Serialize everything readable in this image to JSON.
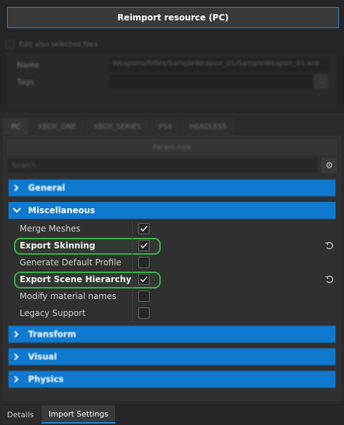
{
  "header": {
    "reimport_label": "Reimport resource (PC)",
    "edit_also_label": "Edit also selected files"
  },
  "properties": {
    "name_label": "Name",
    "name_value": "Weapons/Rifles/SampleWeapon_01/SampleWeapon_01.xob",
    "tags_label": "Tags",
    "tags_value": "",
    "tags_button": "..."
  },
  "platform_tabs": [
    {
      "label": "PC",
      "active": true
    },
    {
      "label": "XBOX_ONE",
      "active": false
    },
    {
      "label": "XBOX_SERIES",
      "active": false
    },
    {
      "label": "PS4",
      "active": false
    },
    {
      "label": "HEADLESS",
      "active": false
    }
  ],
  "toolbar": {
    "param_button": "Param new",
    "search_placeholder": "Search"
  },
  "sections": {
    "general": {
      "label": "General",
      "expanded": false
    },
    "misc": {
      "label": "Miscellaneous",
      "expanded": true
    },
    "transform": {
      "label": "Transform",
      "expanded": false
    },
    "visual": {
      "label": "Visual",
      "expanded": false
    },
    "physics": {
      "label": "Physics",
      "expanded": false
    }
  },
  "misc_rows": [
    {
      "label": "Merge Meshes",
      "checked": true,
      "bold": false,
      "reset": false
    },
    {
      "label": "Export Skinning",
      "checked": true,
      "bold": true,
      "reset": true
    },
    {
      "label": "Generate Default Profile",
      "checked": false,
      "bold": false,
      "reset": false
    },
    {
      "label": "Export Scene Hierarchy",
      "checked": true,
      "bold": true,
      "reset": true
    },
    {
      "label": "Modify material names",
      "checked": false,
      "bold": false,
      "reset": false
    },
    {
      "label": "Legacy Support",
      "checked": false,
      "bold": false,
      "reset": false
    }
  ],
  "bottom_tabs": [
    {
      "label": "Details",
      "active": false
    },
    {
      "label": "Import Settings",
      "active": true
    }
  ],
  "colors": {
    "accent": "#0e79cf",
    "highlight": "#3ab54a",
    "focus_border": "#1a8ae0"
  }
}
